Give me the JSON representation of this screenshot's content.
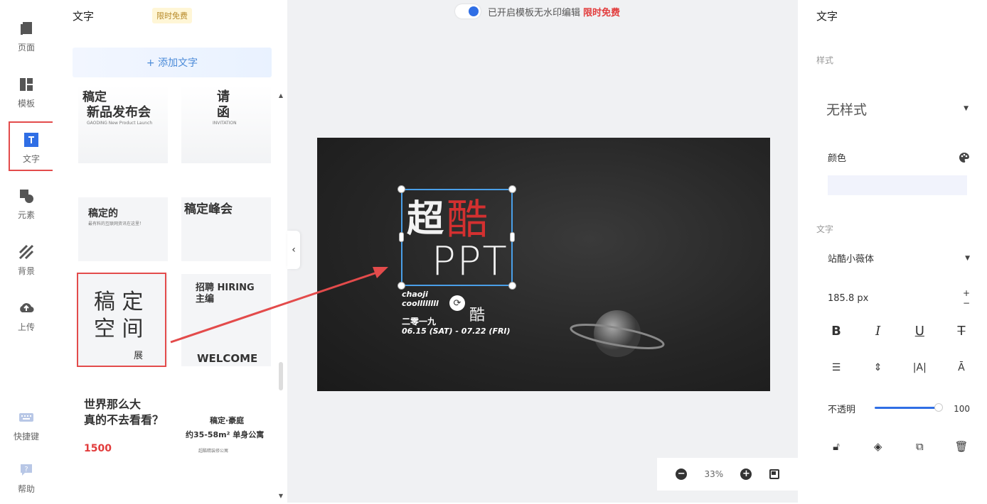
{
  "rail": {
    "items": [
      {
        "label": "页面",
        "icon": "page-icon"
      },
      {
        "label": "模板",
        "icon": "template-icon"
      },
      {
        "label": "文字",
        "icon": "text-icon"
      },
      {
        "label": "元素",
        "icon": "element-icon"
      },
      {
        "label": "背景",
        "icon": "background-icon"
      },
      {
        "label": "上传",
        "icon": "upload-icon"
      }
    ],
    "bottom": [
      {
        "label": "快捷键",
        "icon": "keyboard-icon"
      },
      {
        "label": "帮助",
        "icon": "help-icon"
      }
    ]
  },
  "panel": {
    "title": "文字",
    "badge": "限时免费",
    "add_button": "+ 添加文字",
    "templates": [
      {
        "l1": "稿定",
        "l2": "新品发布会",
        "sub": "GAODING New Product Launch"
      },
      {
        "l1": "请",
        "l2": "函",
        "sub": "INVITATION"
      },
      {
        "l1": "稿定的",
        "l2": "最有料的互联网资讯在这里！"
      },
      {
        "l1": "稿定峰会",
        "l2": ""
      },
      {
        "l1": "稿 定",
        "l2": "空 间",
        "sub": "展"
      },
      {
        "l1": "招聘 HIRING",
        "l2": "主编",
        "sub": "WELCOME"
      },
      {
        "l1": "世界那么大",
        "l2": "真的不去看看？",
        "sub": "1500"
      },
      {
        "l1": "稿定·豪庭",
        "l2": "约35-58m² 单身公寓",
        "sub": "超酷精装修公寓"
      }
    ]
  },
  "watermark": {
    "text": "已开启模板无水印编辑",
    "free": "限时免费"
  },
  "slide": {
    "title_chars": [
      "超",
      "酷"
    ],
    "ppt": "PPT",
    "small_lines": [
      "chaoji",
      "coollllllll"
    ],
    "small_cn": "二零一九",
    "date": "06.15 (SAT) - 07.22 (FRI)",
    "ku2": "酷"
  },
  "zoom": {
    "value": "33%"
  },
  "right": {
    "title": "文字",
    "style_section": "样式",
    "style_value": "无样式",
    "color_label": "颜色",
    "text_section": "文字",
    "font": "站酷小薇体",
    "size": "185.8 px",
    "opacity_label": "不透明",
    "opacity_value": "100",
    "opacity_fraction": 1.0
  }
}
